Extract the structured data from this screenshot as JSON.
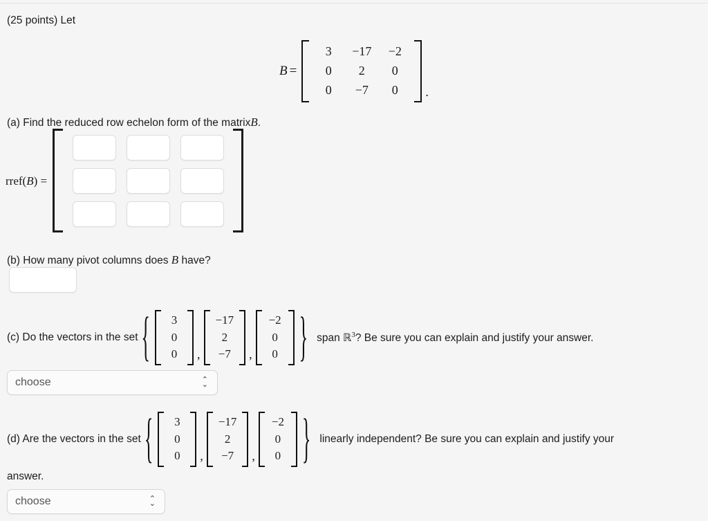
{
  "problem": {
    "points_line": "(25 points) Let",
    "matrix_name": "B",
    "matrix_b": {
      "rows": [
        [
          "3",
          "−17",
          "−2"
        ],
        [
          "0",
          "2",
          "0"
        ],
        [
          "0",
          "−7",
          "0"
        ]
      ],
      "trailing_punctuation": "."
    }
  },
  "part_a": {
    "label": "(a) Find the reduced row echelon form of the matrix",
    "variable": "B",
    "period": ".",
    "rref_label_prefix": "rref(",
    "rref_label_var": "B",
    "rref_label_suffix": ") =",
    "grid_rows": 3,
    "grid_cols": 3,
    "inputs": [
      [
        "",
        "",
        ""
      ],
      [
        "",
        "",
        ""
      ],
      [
        "",
        "",
        ""
      ]
    ],
    "input_placeholder": ""
  },
  "part_b": {
    "label_before": "(b) How many pivot columns does",
    "variable": "B",
    "label_after": "have?",
    "input_value": "",
    "input_placeholder": ""
  },
  "part_c": {
    "label_before": "(c) Do the vectors in the set",
    "open_brace": "{",
    "close_brace": "}",
    "vectors": [
      [
        "3",
        "0",
        "0"
      ],
      [
        "−17",
        "2",
        "−7"
      ],
      [
        "−2",
        "0",
        "0"
      ]
    ],
    "separator": ",",
    "tail_before_r": "span",
    "blackboard_r": "ℝ",
    "exponent": "3",
    "tail_after_r": "? Be sure you can explain and justify your answer.",
    "dropdown": {
      "value": "choose",
      "chevron_up": "⌃",
      "chevron_down": "⌄"
    }
  },
  "part_d": {
    "label_before": "(d) Are the vectors in the set",
    "open_brace": "{",
    "close_brace": "}",
    "vectors": [
      [
        "3",
        "0",
        "0"
      ],
      [
        "−17",
        "2",
        "−7"
      ],
      [
        "−2",
        "0",
        "0"
      ]
    ],
    "separator": ",",
    "tail_text": "linearly independent? Be sure you can explain and justify your",
    "wrapped_text": "answer.",
    "dropdown": {
      "value": "choose",
      "chevron_up": "⌃",
      "chevron_down": "⌄"
    }
  },
  "colors": {
    "background": "#f5f5f5",
    "text": "#1c1c1c",
    "input_border": "#dcdcdc",
    "input_background": "#ffffff",
    "dropdown_border": "#d6d6d6",
    "bracket": "#111111"
  }
}
